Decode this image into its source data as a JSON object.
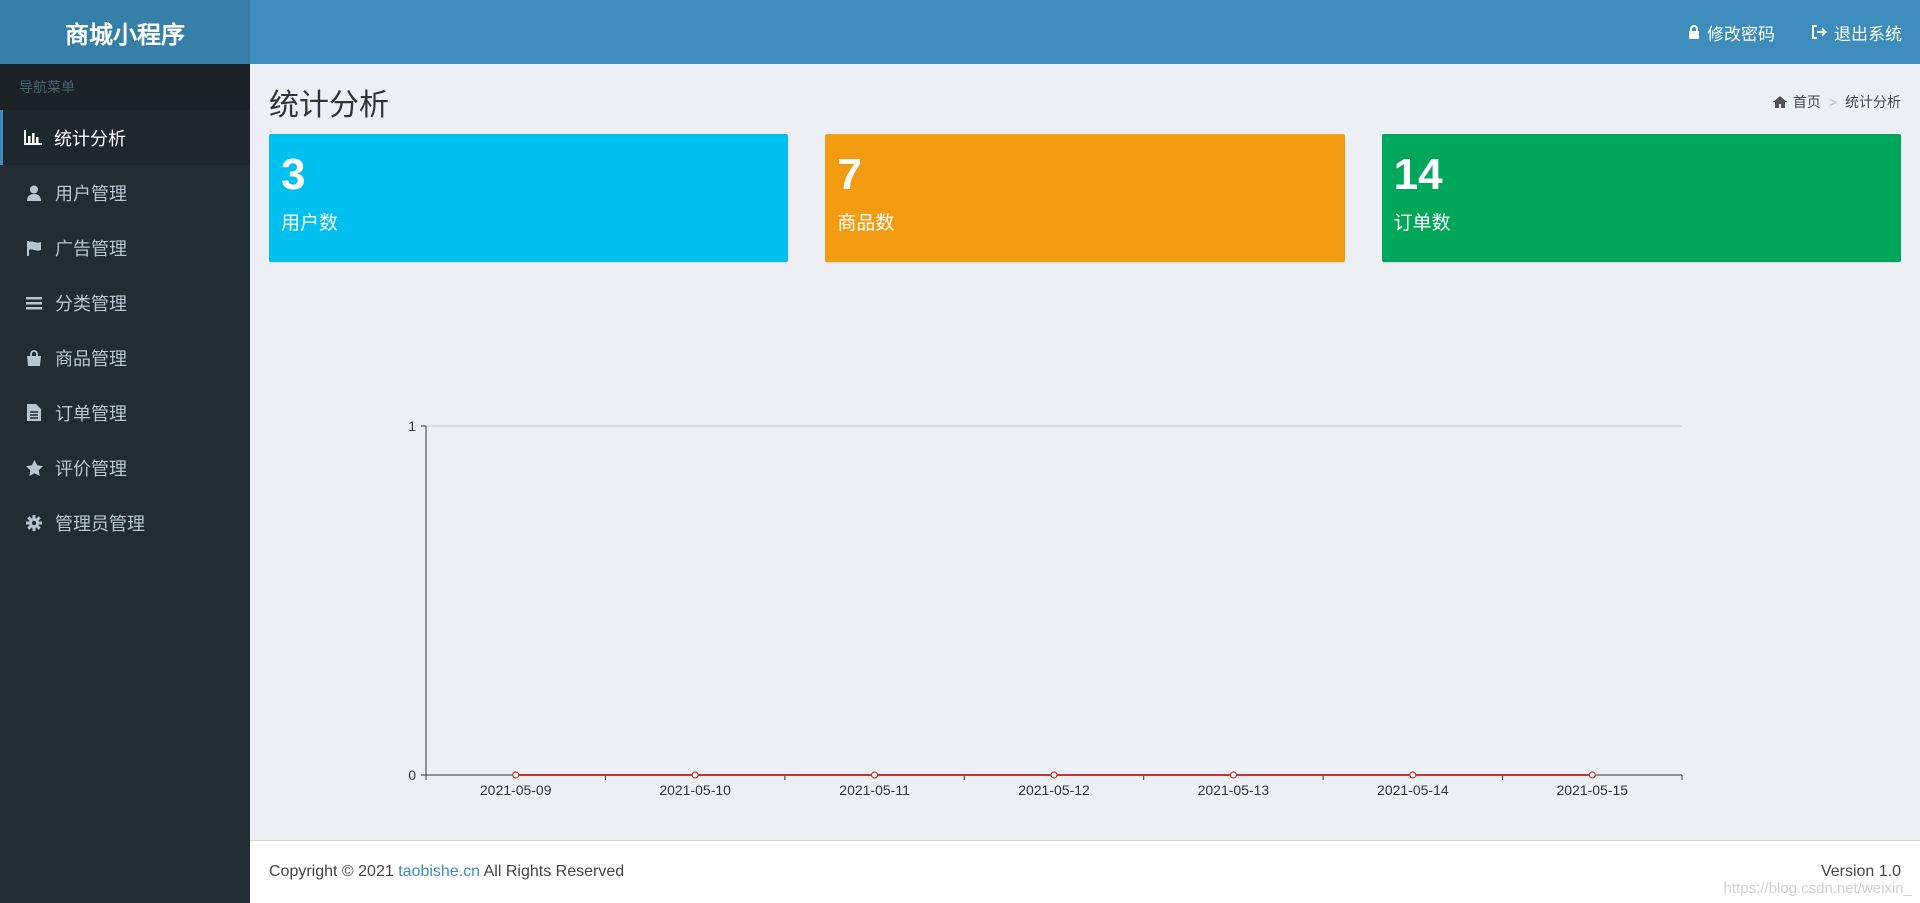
{
  "app": {
    "title": "商城小程序"
  },
  "topbar": {
    "change_password": "修改密码",
    "logout": "退出系统"
  },
  "sidebar": {
    "header": "导航菜单",
    "items": [
      {
        "label": "统计分析",
        "icon": "bar-chart-icon"
      },
      {
        "label": "用户管理",
        "icon": "user-icon"
      },
      {
        "label": "广告管理",
        "icon": "flag-icon"
      },
      {
        "label": "分类管理",
        "icon": "list-icon"
      },
      {
        "label": "商品管理",
        "icon": "shopping-bag-icon"
      },
      {
        "label": "订单管理",
        "icon": "file-icon"
      },
      {
        "label": "评价管理",
        "icon": "star-icon"
      },
      {
        "label": "管理员管理",
        "icon": "gear-icon"
      }
    ]
  },
  "page": {
    "title": "统计分析"
  },
  "breadcrumb": {
    "home": "首页",
    "sep": ">",
    "current": "统计分析"
  },
  "stats": [
    {
      "value": "3",
      "label": "用户数",
      "color": "#00c0ef"
    },
    {
      "value": "7",
      "label": "商品数",
      "color": "#f39c12"
    },
    {
      "value": "14",
      "label": "订单数",
      "color": "#00a65a"
    }
  ],
  "chart_data": {
    "type": "line",
    "x": [
      "2021-05-09",
      "2021-05-10",
      "2021-05-11",
      "2021-05-12",
      "2021-05-13",
      "2021-05-14",
      "2021-05-15"
    ],
    "series": [
      {
        "values": [
          0,
          0,
          0,
          0,
          0,
          0,
          0
        ],
        "color": "#c23531"
      }
    ],
    "ylim": [
      0,
      1
    ],
    "yticks": [
      "0",
      "1"
    ],
    "title": "",
    "xlabel": "",
    "ylabel": "",
    "grid": true
  },
  "footer": {
    "copyright_prefix": "Copyright © 2021 ",
    "link_text": "taobishe.cn",
    "copyright_suffix": " All Rights Reserved",
    "version": "Version 1.0"
  },
  "watermark": "https://blog.csdn.net/weixin_"
}
